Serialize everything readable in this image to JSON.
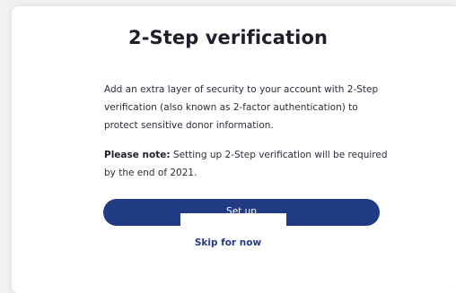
{
  "dialog": {
    "title": "2-Step verification",
    "description": "Add an extra layer of security to your account with 2-Step verification (also known as 2-factor authentication) to protect sensitive donor information.",
    "note_label": "Please note:",
    "note_text": " Setting up 2-Step verification will be required by the end of 2021.",
    "primary_button_label": "Set up",
    "skip_link_label": "Skip for now"
  },
  "colors": {
    "primary": "#213b84",
    "background": "#f1f1f3",
    "card": "#ffffff",
    "text": "#2b2d38"
  }
}
